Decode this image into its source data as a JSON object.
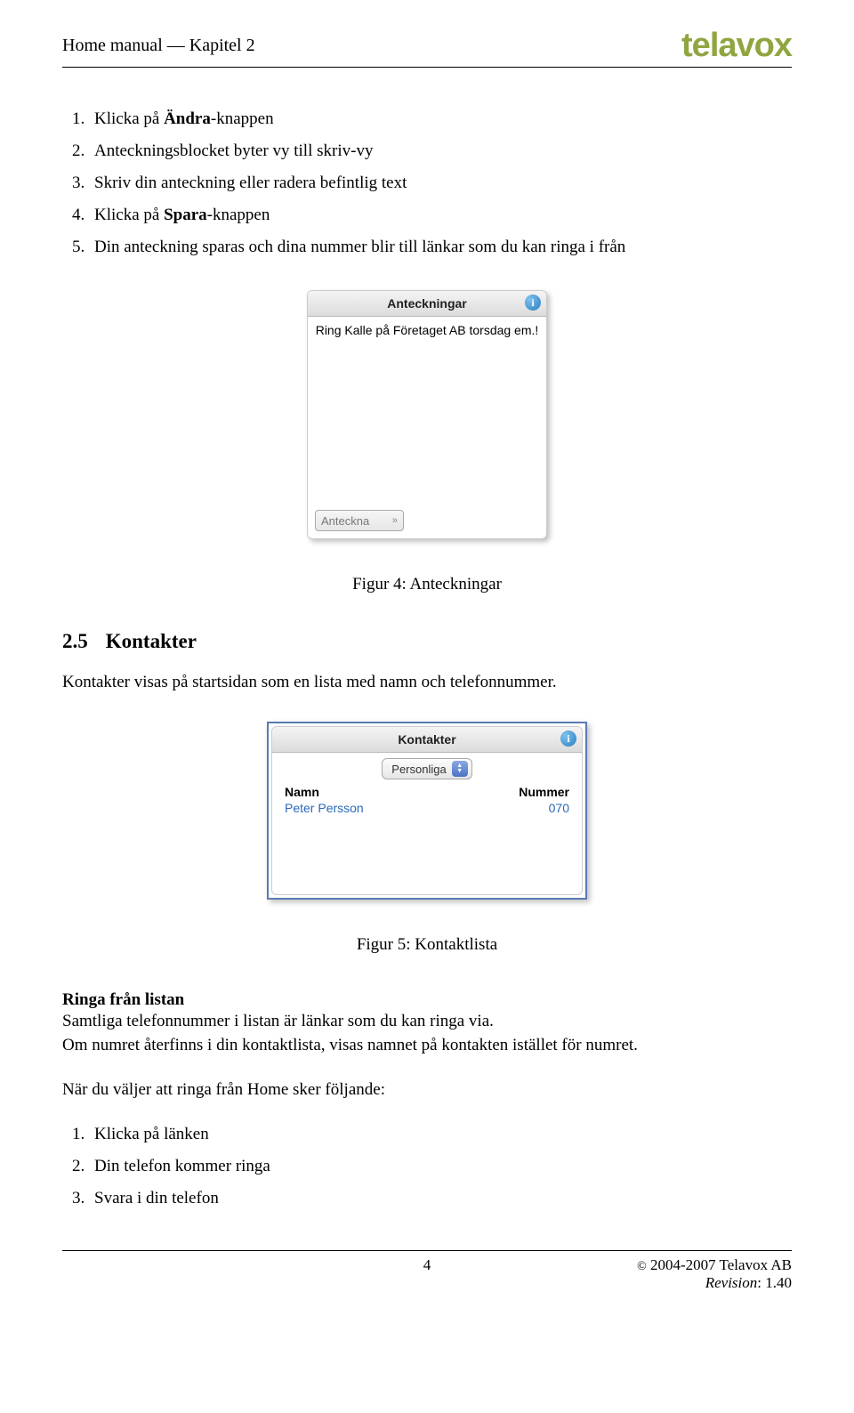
{
  "header": {
    "title": "Home manual — Kapitel 2",
    "logo": "telavox"
  },
  "steps1": {
    "items": [
      {
        "prefix": "Klicka på ",
        "bold": "Ändra",
        "suffix": "-knappen"
      },
      {
        "prefix": "Anteckningsblocket byter vy till skriv-vy",
        "bold": "",
        "suffix": ""
      },
      {
        "prefix": "Skriv din anteckning eller radera befintlig text",
        "bold": "",
        "suffix": ""
      },
      {
        "prefix": "Klicka på ",
        "bold": "Spara",
        "suffix": "-knappen"
      },
      {
        "prefix": "Din anteckning sparas och dina nummer blir till länkar som du kan ringa i från",
        "bold": "",
        "suffix": ""
      }
    ]
  },
  "fig4": {
    "panel_title": "Anteckningar",
    "note_text": "Ring Kalle på Företaget AB torsdag em.!",
    "input_placeholder": "Anteckna",
    "caption": "Figur 4: Anteckningar"
  },
  "section25": {
    "num": "2.5",
    "title": "Kontakter",
    "intro": "Kontakter visas på startsidan som en lista med namn och telefonnummer."
  },
  "fig5": {
    "panel_title": "Kontakter",
    "dropdown_label": "Personliga",
    "col_name": "Namn",
    "col_number": "Nummer",
    "row_name": "Peter Persson",
    "row_number": "070",
    "caption": "Figur 5: Kontaktlista"
  },
  "ringa": {
    "heading": "Ringa från listan",
    "p1": "Samtliga telefonnummer i listan är länkar som du kan ringa via.",
    "p2": "Om numret återfinns i din kontaktlista, visas namnet på kontakten istället för numret.",
    "p3": "När du väljer att ringa från Home sker följande:"
  },
  "steps2": {
    "items": [
      "Klicka på länken",
      "Din telefon kommer ringa",
      "Svara i din telefon"
    ]
  },
  "footer": {
    "page": "4",
    "copyright": "2004-2007 Telavox AB",
    "revision_label": "Revision",
    "revision_value": ": 1.40"
  }
}
